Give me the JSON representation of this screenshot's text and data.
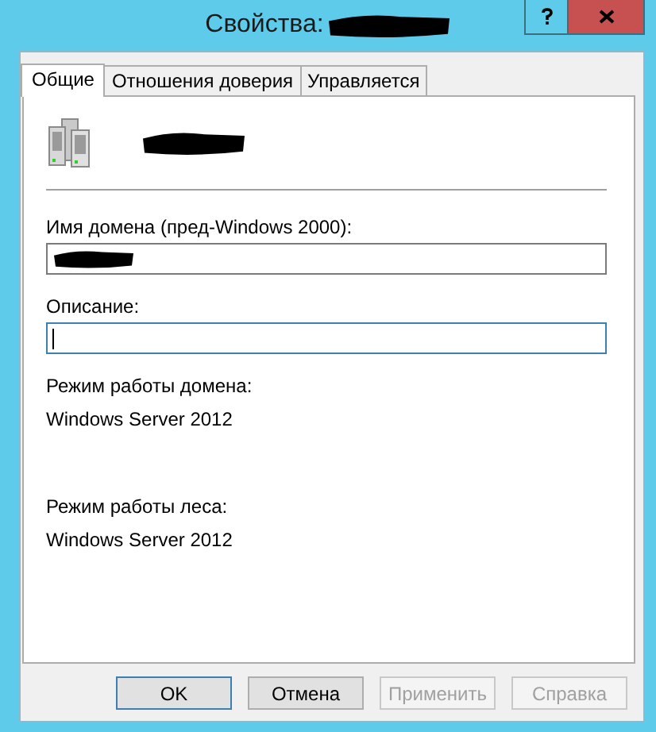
{
  "window": {
    "title": "Свойства:"
  },
  "tabs": [
    {
      "label": "Общие",
      "selected": true
    },
    {
      "label": "Отношения доверия",
      "selected": false
    },
    {
      "label": "Управляется",
      "selected": false
    }
  ],
  "fields": [
    {
      "label": "Имя домена (пред-Windows 2000):",
      "focused": false
    },
    {
      "label": "Описание:",
      "focused": true
    }
  ],
  "info": [
    {
      "label": "Режим работы домена:",
      "value": "Windows Server 2012"
    },
    {
      "label": "Режим работы леса:",
      "value": "Windows Server 2012"
    }
  ],
  "buttons": [
    {
      "label": "OK",
      "default": true,
      "disabled": false
    },
    {
      "label": "Отмена",
      "default": false,
      "disabled": false
    },
    {
      "label": "Применить",
      "default": false,
      "disabled": true
    },
    {
      "label": "Справка",
      "default": false,
      "disabled": true
    }
  ]
}
